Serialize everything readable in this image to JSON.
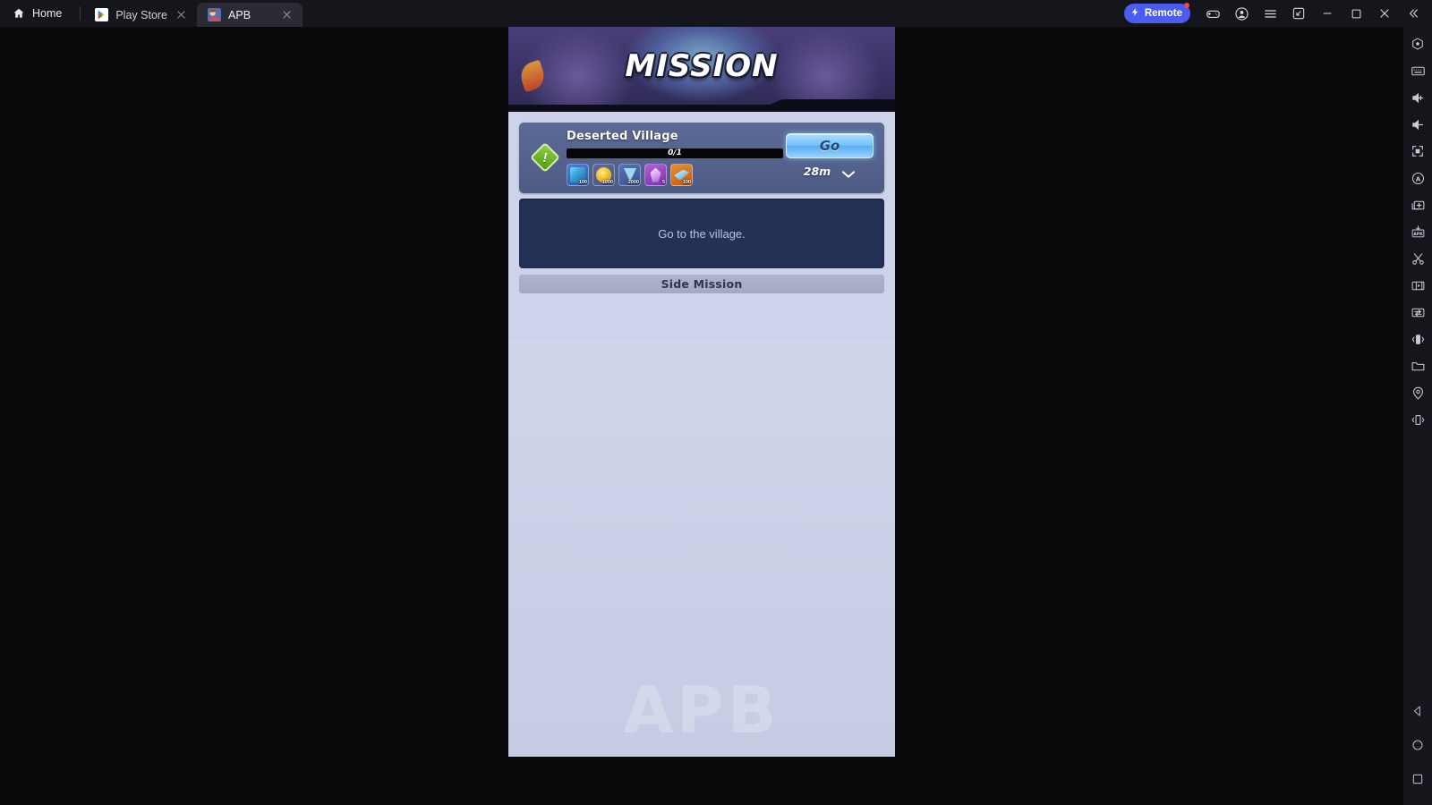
{
  "titlebar": {
    "home_label": "Home",
    "home_icon": "home-icon",
    "tabs": [
      {
        "label": "Play Store",
        "icon": "play-store-icon",
        "active": false,
        "close_icon": "close-icon"
      },
      {
        "label": "APB",
        "icon": "apb-app-icon",
        "active": true,
        "close_icon": "close-icon"
      }
    ],
    "remote": {
      "label": "Remote",
      "icon": "lightning-bolt-icon",
      "badge": true,
      "color": "#4a5df0"
    },
    "icons": [
      "gamepad-icon",
      "account-icon",
      "menu-icon",
      "screenshot-icon",
      "minimize-icon",
      "maximize-icon",
      "close-icon",
      "collapse-sidebar-icon"
    ]
  },
  "sidebar": {
    "items": [
      "settings-hexagon-icon",
      "keyboard-icon",
      "volume-up-icon",
      "volume-down-icon",
      "fullscreen-icon",
      "auto-rotate-icon",
      "multi-instance-icon",
      "apk-install-icon",
      "scissors-icon",
      "screen-record-icon",
      "file-transfer-icon",
      "shake-icon",
      "folder-icon",
      "location-pin-icon",
      "device-rotate-icon"
    ],
    "nav": [
      "back-icon",
      "home-circle-icon",
      "recents-square-icon"
    ]
  },
  "game": {
    "banner": {
      "title": "MISSION"
    },
    "mission_card": {
      "badge_icon": "quest-exclamation-icon",
      "title": "Deserted Village",
      "progress": {
        "text": "0/1",
        "current": 0,
        "total": 1,
        "percent": 0
      },
      "rewards": [
        {
          "name": "reward-art-item",
          "count": "100",
          "icon": "pixel-art-icon",
          "color": "#2e5aa8"
        },
        {
          "name": "reward-gold",
          "count": "1000",
          "icon": "gold-coin-icon",
          "color": "#f0b81e"
        },
        {
          "name": "reward-water-gem",
          "count": "2000",
          "icon": "water-gem-icon",
          "color": "#9fd8f5"
        },
        {
          "name": "reward-crystal",
          "count": "5",
          "icon": "purple-crystal-icon",
          "color": "#9c56c8"
        },
        {
          "name": "reward-blue-shard",
          "count": "100",
          "icon": "blue-shard-icon",
          "color": "#c05a14"
        }
      ],
      "go_label": "Go",
      "timer": "28m",
      "expand_icon": "chevron-down-icon"
    },
    "objective": {
      "text": "Go to the village."
    },
    "side_mission": {
      "label": "Side Mission"
    },
    "watermark": "APB"
  }
}
